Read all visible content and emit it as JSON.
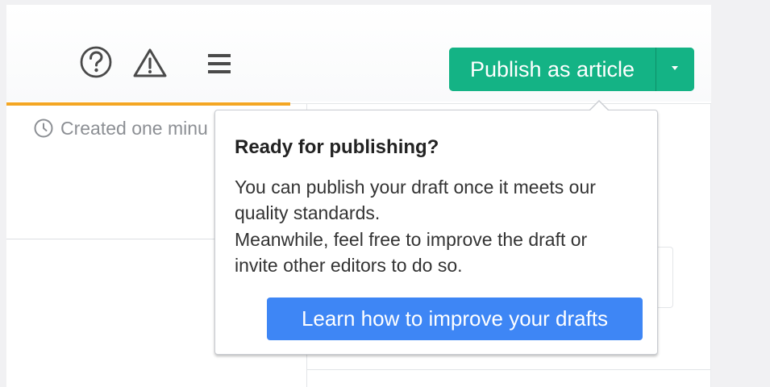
{
  "toolbar": {
    "icons": [
      "help-icon",
      "warning-icon",
      "menu-icon"
    ],
    "publish_label": "Publish as article",
    "publish_color": "#14b385",
    "dropdown_icon": "caret-down-icon"
  },
  "tab": {
    "progress_color": "#f4a623"
  },
  "meta": {
    "clock_icon": "clock-icon",
    "created_text": "Created one minu"
  },
  "popover": {
    "title": "Ready for publishing?",
    "body_lines": [
      "You can publish your draft once it meets our",
      "quality standards.",
      "Meanwhile, feel free to improve the draft or",
      "invite other editors to do so."
    ],
    "learn_label": "Learn how to improve your drafts",
    "learn_color": "#3e86f5"
  }
}
